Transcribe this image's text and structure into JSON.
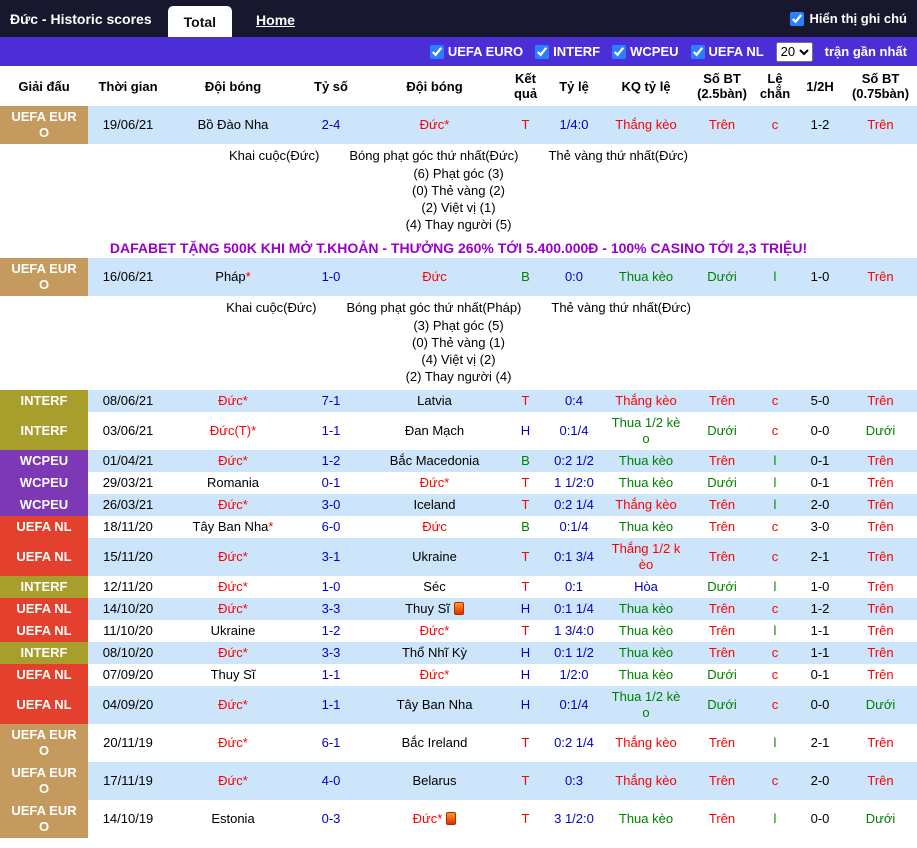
{
  "topbar": {
    "title": "Đức - Historic scores",
    "tabs": [
      {
        "label": "Total",
        "active": true
      },
      {
        "label": "Home",
        "active": false
      }
    ],
    "note_label": "Hiển thị ghi chú",
    "note_checked": true
  },
  "filterbar": {
    "filters": [
      {
        "label": "UEFA EURO",
        "checked": true
      },
      {
        "label": "INTERF",
        "checked": true
      },
      {
        "label": "WCPEU",
        "checked": true
      },
      {
        "label": "UEFA NL",
        "checked": true
      }
    ],
    "count_selected": "20",
    "count_suffix": "trận gần nhất"
  },
  "colors": {
    "win_red": "#ff0000",
    "loss_green": "#008000",
    "draw_blue": "#0000cc",
    "row_shade": "#cce5fa",
    "topbar_bg": "#17172e",
    "filterbar_bg": "#4c2ed6",
    "ad_purple": "#9900cc",
    "league_colors": {
      "UEFA EURO": "#c49a5e",
      "INTERF": "#a89e2c",
      "WCPEU": "#7d39b5",
      "UEFA NL": "#e4402e"
    }
  },
  "table": {
    "headers": [
      "Giải đấu",
      "Thời gian",
      "Đội bóng",
      "Tỷ số",
      "Đội bóng",
      "Kết quả",
      "Tỷ lệ",
      "KQ tỷ lệ",
      "Số BT (2.5bàn)",
      "Lệ chẵn",
      "1/2H",
      "Số BT (0.75bàn)"
    ],
    "rows": [
      {
        "league": "UEFA EURO",
        "date": "19/06/21",
        "team1": {
          "name": "Bồ Đào Nha"
        },
        "score": "2-4",
        "team2": {
          "name": "Đức",
          "star": true,
          "red": true
        },
        "result": "T",
        "result_c": "r",
        "odds": "1/4:0",
        "kq": "Thắng kèo",
        "kq_c": "r",
        "bt25": "Trên",
        "bt25_c": "r",
        "le": "c",
        "le_c": "r",
        "ht": "1-2",
        "bt075": "Trên",
        "bt075_c": "r",
        "shade": true,
        "note": {
          "header": [
            "Khai cuộc(Đức)",
            "Bóng phạt góc thứ nhất(Đức)",
            "Thẻ vàng thứ nhất(Đức)"
          ],
          "lines": [
            "(6) Phạt góc (3)",
            "(0) Thẻ vàng (2)",
            "(2) Việt vị (1)",
            "(4) Thay người (5)"
          ]
        },
        "ad": "DAFABET TẶNG 500K KHI MỞ T.KHOẢN - THƯỞNG 260% TỚI 5.400.000Đ - 100% CASINO TỚI 2,3 TRIỆU!"
      },
      {
        "league": "UEFA EURO",
        "date": "16/06/21",
        "team1": {
          "name": "Pháp",
          "star": true
        },
        "score": "1-0",
        "team2": {
          "name": "Đức",
          "red": true
        },
        "result": "B",
        "result_c": "g",
        "odds": "0:0",
        "kq": "Thua kèo",
        "kq_c": "g",
        "bt25": "Dưới",
        "bt25_c": "g",
        "le": "l",
        "le_c": "g",
        "ht": "1-0",
        "bt075": "Trên",
        "bt075_c": "r",
        "shade": true,
        "note": {
          "header": [
            "Khai cuộc(Đức)",
            "Bóng phạt góc thứ nhất(Pháp)",
            "Thẻ vàng thứ nhất(Đức)"
          ],
          "lines": [
            "(3) Phạt góc (5)",
            "(0) Thẻ vàng (1)",
            "(4) Việt vị (2)",
            "(2) Thay người (4)"
          ]
        }
      },
      {
        "league": "INTERF",
        "date": "08/06/21",
        "team1": {
          "name": "Đức",
          "star": true,
          "red": true
        },
        "score": "7-1",
        "team2": {
          "name": "Latvia"
        },
        "result": "T",
        "result_c": "r",
        "odds": "0:4",
        "kq": "Thắng kèo",
        "kq_c": "r",
        "bt25": "Trên",
        "bt25_c": "r",
        "le": "c",
        "le_c": "r",
        "ht": "5-0",
        "bt075": "Trên",
        "bt075_c": "r",
        "shade": true
      },
      {
        "league": "INTERF",
        "date": "03/06/21",
        "team1": {
          "name": "Đức(T)",
          "star": true,
          "red": true
        },
        "score": "1-1",
        "team2": {
          "name": "Đan Mạch"
        },
        "result": "H",
        "result_c": "b",
        "odds": "0:1/4",
        "kq": "Thua 1/2 kèo",
        "kq_c": "g",
        "bt25": "Dưới",
        "bt25_c": "g",
        "le": "c",
        "le_c": "r",
        "ht": "0-0",
        "bt075": "Dưới",
        "bt075_c": "g",
        "shade": false
      },
      {
        "league": "WCPEU",
        "date": "01/04/21",
        "team1": {
          "name": "Đức",
          "star": true,
          "red": true
        },
        "score": "1-2",
        "team2": {
          "name": "Bắc Macedonia"
        },
        "result": "B",
        "result_c": "g",
        "odds": "0:2 1/2",
        "kq": "Thua kèo",
        "kq_c": "g",
        "bt25": "Trên",
        "bt25_c": "r",
        "le": "l",
        "le_c": "g",
        "ht": "0-1",
        "bt075": "Trên",
        "bt075_c": "r",
        "shade": true
      },
      {
        "league": "WCPEU",
        "date": "29/03/21",
        "team1": {
          "name": "Romania"
        },
        "score": "0-1",
        "team2": {
          "name": "Đức",
          "star": true,
          "red": true
        },
        "result": "T",
        "result_c": "r",
        "odds": "1 1/2:0",
        "kq": "Thua kèo",
        "kq_c": "g",
        "bt25": "Dưới",
        "bt25_c": "g",
        "le": "l",
        "le_c": "g",
        "ht": "0-1",
        "bt075": "Trên",
        "bt075_c": "r",
        "shade": false
      },
      {
        "league": "WCPEU",
        "date": "26/03/21",
        "team1": {
          "name": "Đức",
          "star": true,
          "red": true
        },
        "score": "3-0",
        "team2": {
          "name": "Iceland"
        },
        "result": "T",
        "result_c": "r",
        "odds": "0:2 1/4",
        "kq": "Thắng kèo",
        "kq_c": "r",
        "bt25": "Trên",
        "bt25_c": "r",
        "le": "l",
        "le_c": "g",
        "ht": "2-0",
        "bt075": "Trên",
        "bt075_c": "r",
        "shade": true
      },
      {
        "league": "UEFA NL",
        "date": "18/11/20",
        "team1": {
          "name": "Tây Ban Nha",
          "star": true
        },
        "score": "6-0",
        "team2": {
          "name": "Đức",
          "red": true
        },
        "result": "B",
        "result_c": "g",
        "odds": "0:1/4",
        "kq": "Thua kèo",
        "kq_c": "g",
        "bt25": "Trên",
        "bt25_c": "r",
        "le": "c",
        "le_c": "r",
        "ht": "3-0",
        "bt075": "Trên",
        "bt075_c": "r",
        "shade": false
      },
      {
        "league": "UEFA NL",
        "date": "15/11/20",
        "team1": {
          "name": "Đức",
          "star": true,
          "red": true
        },
        "score": "3-1",
        "team2": {
          "name": "Ukraine"
        },
        "result": "T",
        "result_c": "r",
        "odds": "0:1 3/4",
        "kq": "Thắng 1/2 kèo",
        "kq_c": "r",
        "bt25": "Trên",
        "bt25_c": "r",
        "le": "c",
        "le_c": "r",
        "ht": "2-1",
        "bt075": "Trên",
        "bt075_c": "r",
        "shade": true
      },
      {
        "league": "INTERF",
        "date": "12/11/20",
        "team1": {
          "name": "Đức",
          "star": true,
          "red": true
        },
        "score": "1-0",
        "team2": {
          "name": "Séc"
        },
        "result": "T",
        "result_c": "r",
        "odds": "0:1",
        "kq": "Hòa",
        "kq_c": "b",
        "bt25": "Dưới",
        "bt25_c": "g",
        "le": "l",
        "le_c": "g",
        "ht": "1-0",
        "bt075": "Trên",
        "bt075_c": "r",
        "shade": false
      },
      {
        "league": "UEFA NL",
        "date": "14/10/20",
        "team1": {
          "name": "Đức",
          "star": true,
          "red": true
        },
        "score": "3-3",
        "team2": {
          "name": "Thuy Sĩ",
          "icon": true
        },
        "result": "H",
        "result_c": "b",
        "odds": "0:1 1/4",
        "kq": "Thua kèo",
        "kq_c": "g",
        "bt25": "Trên",
        "bt25_c": "r",
        "le": "c",
        "le_c": "r",
        "ht": "1-2",
        "bt075": "Trên",
        "bt075_c": "r",
        "shade": true
      },
      {
        "league": "UEFA NL",
        "date": "11/10/20",
        "team1": {
          "name": "Ukraine"
        },
        "score": "1-2",
        "team2": {
          "name": "Đức",
          "star": true,
          "red": true
        },
        "result": "T",
        "result_c": "r",
        "odds": "1 3/4:0",
        "kq": "Thua kèo",
        "kq_c": "g",
        "bt25": "Trên",
        "bt25_c": "r",
        "le": "l",
        "le_c": "g",
        "ht": "1-1",
        "bt075": "Trên",
        "bt075_c": "r",
        "shade": false
      },
      {
        "league": "INTERF",
        "date": "08/10/20",
        "team1": {
          "name": "Đức",
          "star": true,
          "red": true
        },
        "score": "3-3",
        "team2": {
          "name": "Thổ Nhĩ Kỳ"
        },
        "result": "H",
        "result_c": "b",
        "odds": "0:1 1/2",
        "kq": "Thua kèo",
        "kq_c": "g",
        "bt25": "Trên",
        "bt25_c": "r",
        "le": "c",
        "le_c": "r",
        "ht": "1-1",
        "bt075": "Trên",
        "bt075_c": "r",
        "shade": true
      },
      {
        "league": "UEFA NL",
        "date": "07/09/20",
        "team1": {
          "name": "Thuy Sĩ"
        },
        "score": "1-1",
        "team2": {
          "name": "Đức",
          "star": true,
          "red": true
        },
        "result": "H",
        "result_c": "b",
        "odds": "1/2:0",
        "kq": "Thua kèo",
        "kq_c": "g",
        "bt25": "Dưới",
        "bt25_c": "g",
        "le": "c",
        "le_c": "r",
        "ht": "0-1",
        "bt075": "Trên",
        "bt075_c": "r",
        "shade": false
      },
      {
        "league": "UEFA NL",
        "date": "04/09/20",
        "team1": {
          "name": "Đức",
          "star": true,
          "red": true
        },
        "score": "1-1",
        "team2": {
          "name": "Tây Ban Nha"
        },
        "result": "H",
        "result_c": "b",
        "odds": "0:1/4",
        "kq": "Thua 1/2 kèo",
        "kq_c": "g",
        "bt25": "Dưới",
        "bt25_c": "g",
        "le": "c",
        "le_c": "r",
        "ht": "0-0",
        "bt075": "Dưới",
        "bt075_c": "g",
        "shade": true
      },
      {
        "league": "UEFA EURO",
        "date": "20/11/19",
        "team1": {
          "name": "Đức",
          "star": true,
          "red": true
        },
        "score": "6-1",
        "team2": {
          "name": "Bắc Ireland"
        },
        "result": "T",
        "result_c": "r",
        "odds": "0:2 1/4",
        "kq": "Thắng kèo",
        "kq_c": "r",
        "bt25": "Trên",
        "bt25_c": "r",
        "le": "l",
        "le_c": "g",
        "ht": "2-1",
        "bt075": "Trên",
        "bt075_c": "r",
        "shade": false
      },
      {
        "league": "UEFA EURO",
        "date": "17/11/19",
        "team1": {
          "name": "Đức",
          "star": true,
          "red": true
        },
        "score": "4-0",
        "team2": {
          "name": "Belarus"
        },
        "result": "T",
        "result_c": "r",
        "odds": "0:3",
        "kq": "Thắng kèo",
        "kq_c": "r",
        "bt25": "Trên",
        "bt25_c": "r",
        "le": "c",
        "le_c": "r",
        "ht": "2-0",
        "bt075": "Trên",
        "bt075_c": "r",
        "shade": true
      },
      {
        "league": "UEFA EURO",
        "date": "14/10/19",
        "team1": {
          "name": "Estonia"
        },
        "score": "0-3",
        "team2": {
          "name": "Đức",
          "star": true,
          "red": true,
          "icon": true
        },
        "result": "T",
        "result_c": "r",
        "odds": "3 1/2:0",
        "kq": "Thua kèo",
        "kq_c": "g",
        "bt25": "Trên",
        "bt25_c": "r",
        "le": "l",
        "le_c": "g",
        "ht": "0-0",
        "bt075": "Dưới",
        "bt075_c": "g",
        "shade": false
      }
    ]
  }
}
